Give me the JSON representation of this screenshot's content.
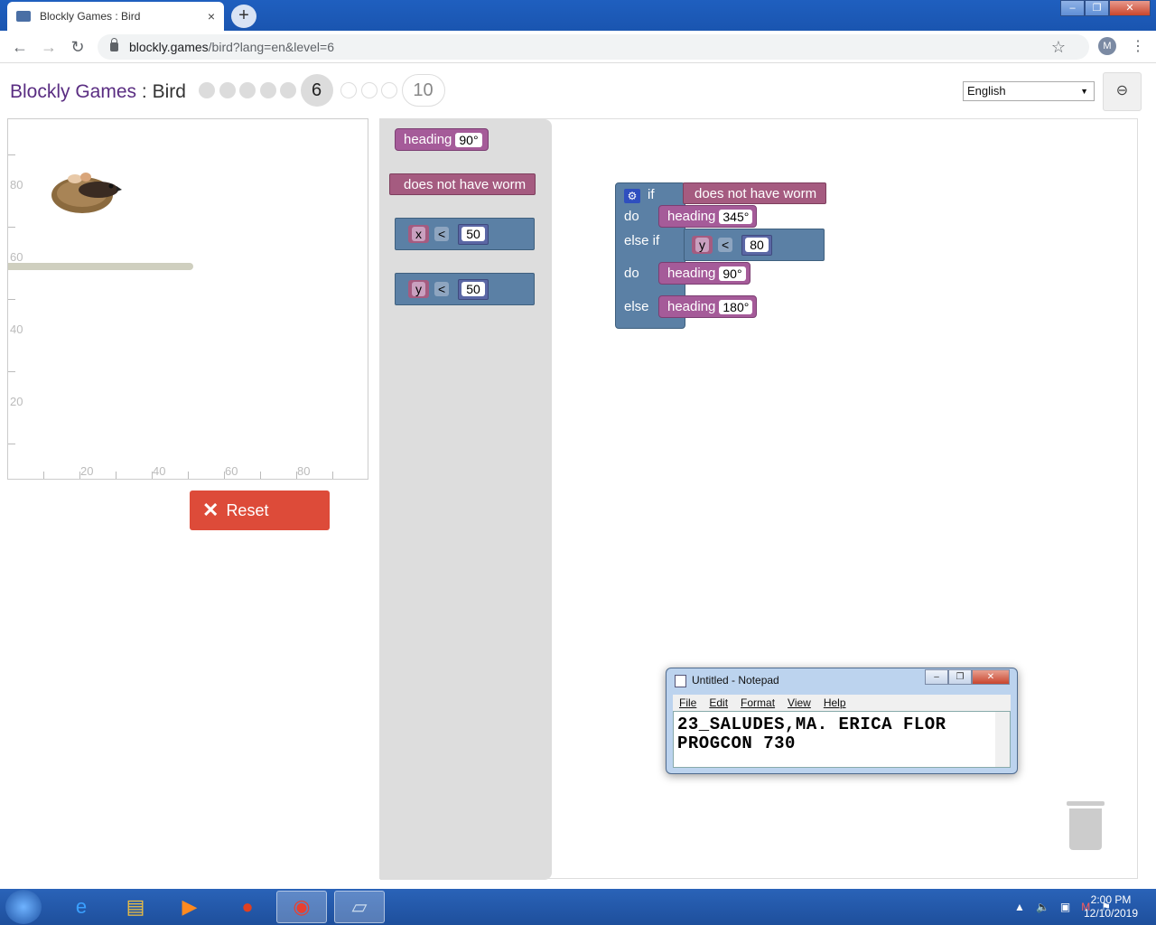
{
  "browser": {
    "tab_title": "Blockly Games : Bird",
    "tab_close": "×",
    "new_tab": "+",
    "url_host": "blockly.games",
    "url_path": "/bird?lang=en&level=6",
    "profile_initial": "M",
    "back": "←",
    "forward": "→",
    "reload": "↻",
    "star": "☆",
    "menu": "⋮"
  },
  "header": {
    "brand": "Blockly Games",
    "separator": " : ",
    "game": "Bird",
    "current_level": "6",
    "last_level": "10",
    "language": "English",
    "language_arrow": "▼",
    "link_icon": "⊖"
  },
  "visualization": {
    "y_ticks": [
      "80",
      "60",
      "40",
      "20"
    ],
    "x_ticks": [
      "20",
      "40",
      "60",
      "80"
    ]
  },
  "reset_button": {
    "icon": "✕",
    "label": "Reset"
  },
  "flyout": {
    "heading_label": "heading",
    "heading_value": "90°",
    "worm_label": "does not have worm",
    "compare_x": {
      "var": "x",
      "op": "<",
      "value": "50"
    },
    "compare_y": {
      "var": "y",
      "op": "<",
      "value": "50"
    }
  },
  "workspace": {
    "if_label": "if",
    "condition1": "does not have worm",
    "do1_label": "do",
    "heading1_label": "heading",
    "heading1_value": "345°",
    "elseif_label": "else if",
    "cond2_var": "y",
    "cond2_op": "<",
    "cond2_value": "80",
    "do2_label": "do",
    "heading2_label": "heading",
    "heading2_value": "90°",
    "else_label": "else",
    "heading3_label": "heading",
    "heading3_value": "180°"
  },
  "notepad": {
    "title": "Untitled - Notepad",
    "menu": [
      "File",
      "Edit",
      "Format",
      "View",
      "Help"
    ],
    "line1": "23_SALUDES,MA. ERICA FLOR",
    "line2": "PROGCON 730"
  },
  "taskbar": {
    "time": "2:00 PM",
    "date": "12/10/2019"
  }
}
